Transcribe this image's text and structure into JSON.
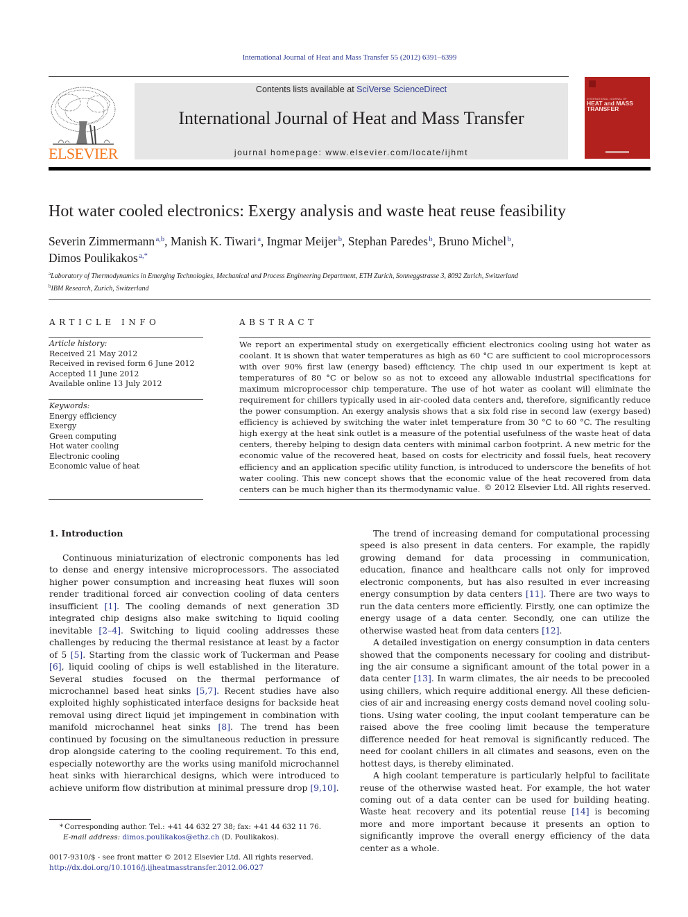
{
  "running_head": "International Journal of Heat and Mass Transfer 55 (2012) 6391–6399",
  "header": {
    "publisher_wordmark": "ELSEVIER",
    "contents_prefix": "Contents lists available at ",
    "contents_link": "SciVerse ScienceDirect",
    "journal_title": "International Journal of Heat and Mass Transfer",
    "homepage_label": "journal homepage: ",
    "homepage_url": "www.elsevier.com/locate/ijhmt",
    "cover": {
      "small_line": "INTERNATIONAL JOURNAL OF",
      "title_line1": "HEAT and MASS",
      "title_line2": "TRANSFER",
      "color": "#b3211f"
    }
  },
  "article": {
    "title": "Hot water cooled electronics: Exergy analysis and waste heat reuse feasibility",
    "authors": [
      {
        "name": "Severin Zimmermann",
        "aff": "a,b",
        "sep": ", "
      },
      {
        "name": "Manish K. Tiwari",
        "aff": "a",
        "sep": ", "
      },
      {
        "name": "Ingmar Meijer",
        "aff": "b",
        "sep": ", "
      },
      {
        "name": "Stephan Paredes",
        "aff": "b",
        "sep": ", "
      },
      {
        "name": "Bruno Michel",
        "aff": "b",
        "sep": ","
      },
      {
        "name": "Dimos Poulikakos",
        "aff": "a,*",
        "sep": ""
      }
    ],
    "affiliations": [
      {
        "key": "a",
        "text": "Laboratory of Thermodynamics in Emerging Technologies, Mechanical and Process Engineering Department, ETH Zurich, Sonneggstrasse 3, 8092 Zurich, Switzerland"
      },
      {
        "key": "b",
        "text": "IBM Research, Zurich, Switzerland"
      }
    ]
  },
  "article_info": {
    "heading": "ARTICLE INFO",
    "history_label": "Article history:",
    "history": [
      "Received 21 May 2012",
      "Received in revised form 6 June 2012",
      "Accepted 11 June 2012",
      "Available online 13 July 2012"
    ],
    "keywords_label": "Keywords:",
    "keywords": [
      "Energy efficiency",
      "Exergy",
      "Green computing",
      "Hot water cooling",
      "Electronic cooling",
      "Economic value of heat"
    ]
  },
  "abstract": {
    "heading": "ABSTRACT",
    "text": "We report an experimental study on exergetically efficient electronics cooling using hot water as coolant. It is shown that water temperatures as high as 60 °C are sufficient to cool microprocessors with over 90% first law (energy based) efficiency. The chip used in our experiment is kept at temperatures of 80 °C or below so as not to exceed any allowable industrial specifications for maximum microprocessor chip tem­perature. The use of hot water as coolant will eliminate the requirement for chillers typically used in air-cooled data centers and, therefore, significantly reduce the power consumption. An exergy analysis shows that a six fold rise in second law (exergy based) efficiency is achieved by switching the water inlet temperature from 30 °C to 60 °C. The resulting high exergy at the heat sink outlet is a measure of the potential usefulness of the waste heat of data centers, thereby helping to design data centers with min­imal carbon footprint. A new metric for the economic value of the recovered heat, based on costs for elec­tricity and fossil fuels, heat recovery efficiency and an application specific utility function, is introduced to underscore the benefits of hot water cooling. This new concept shows that the economic value of the heat recovered from data centers can be much higher than its thermodynamic value.",
    "copyright": "© 2012 Elsevier Ltd. All rights reserved."
  },
  "introduction": {
    "heading": "1. Introduction",
    "left_paragraphs": [
      [
        {
          "t": "Continuous miniaturization of electronic components has led to dense and energy intensive microprocessors. The associated higher power consumption and increasing heat fluxes will soon render traditional forced air convection cooling of data centers insufficient "
        },
        {
          "ref": "[1]"
        },
        {
          "t": ". The cooling demands of next generation 3D integrated chip designs also make switching to liquid cooling inevitable "
        },
        {
          "ref": "[2–4]"
        },
        {
          "t": ". Switching to liquid cooling addresses these challenges by reducing the thermal resistance at least by a factor of 5 "
        },
        {
          "ref": "[5]"
        },
        {
          "t": ". Starting from the classic work of Tuckerman and Pease "
        },
        {
          "ref": "[6]"
        },
        {
          "t": ", liquid cooling of chips is well established in the literature. Several studies focused on the thermal performance of microchannel based heat sinks "
        },
        {
          "ref": "[5,7]"
        },
        {
          "t": ". Recent studies have also exploited highly sophisticated interface designs for backside heat removal using direct liquid jet impinge­ment in combination with manifold microchannel heat sinks "
        },
        {
          "ref": "[8]"
        },
        {
          "t": ". The trend has been continued by focusing on the simultaneous reduction in pressure drop alongside catering to the cooling requirement. To this end, especially noteworthy are the works using manifold microchannel heat sinks with hierarchical designs, which were introduced to achieve uniform flow distribution at minimal pressure drop "
        },
        {
          "ref": "[9,10]"
        },
        {
          "t": "."
        }
      ]
    ],
    "right_paragraphs": [
      [
        {
          "t": "The trend of increasing demand for computational processing speed is also present in data centers. For example, the rapidly growing demand for data processing in communication, education, finance and healthcare calls not only for improved electronic com­ponents, but has also resulted in ever increasing energy consump­tion by data centers "
        },
        {
          "ref": "[11]"
        },
        {
          "t": ". There are two ways to run the data centers more efficiently. Firstly, one can optimize the energy usage of a data center. Secondly, one can utilize the otherwise wasted heat from data centers "
        },
        {
          "ref": "[12]"
        },
        {
          "t": "."
        }
      ],
      [
        {
          "t": "A detailed investigation on energy consumption in data centers showed that the components necessary for cooling and distribut­ing the air consume a significant amount of the total power in a data center "
        },
        {
          "ref": "[13]"
        },
        {
          "t": ". In warm climates, the air needs to be precooled using chillers, which require additional energy. All these deficien­cies of air and increasing energy costs demand novel cooling solu­tions. Using water cooling, the input coolant temperature can be raised above the free cooling limit because the temperature differ­ence needed for heat removal is significantly reduced. The need for coolant chillers in all climates and seasons, even on the hottest days, is thereby eliminated."
        }
      ],
      [
        {
          "t": "A high coolant temperature is particularly helpful to facilitate reuse of the otherwise wasted heat. For example, the hot water coming out of a data center can be used for building heating. Waste heat recovery and its potential reuse "
        },
        {
          "ref": "[14]"
        },
        {
          "t": " is becoming more and more important because it presents an option to significantly im­prove the overall energy efficiency of the data center as a whole."
        }
      ]
    ]
  },
  "footnote": {
    "star": "*",
    "corresponding": "Corresponding author. Tel.: +41 44 632 27 38; fax: +41 44 632 11 76.",
    "email_label": "E-mail address:",
    "email": "dimos.poulikakos@ethz.ch",
    "email_suffix": " (D. Poulikakos)."
  },
  "issn_line": "0017-9310/$ - see front matter © 2012 Elsevier Ltd. All rights reserved.",
  "doi": "http://dx.doi.org/10.1016/j.ijheatmasstransfer.2012.06.027",
  "colors": {
    "link": "#2b3990",
    "elsevier_orange": "#f47920",
    "header_box": "#e6e6e6"
  }
}
